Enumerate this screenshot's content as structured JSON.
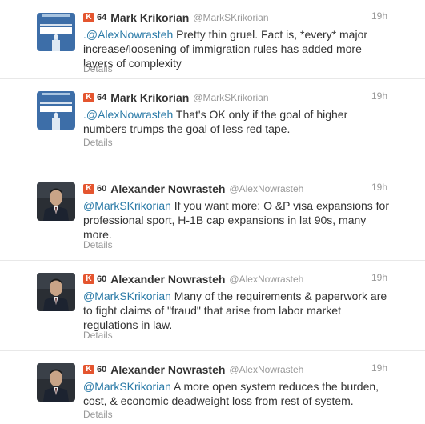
{
  "details_label": "Details",
  "tweets": [
    {
      "klout": "64",
      "name": "Mark Krikorian",
      "handle": "@MarkSKrikorian",
      "time": "19h",
      "mention": ".@AlexNowrasteh",
      "body": " Pretty thin gruel. Fact is, *every* major increase/loosening of immigration rules has added more layers of complexity",
      "avatar": "immigration-book-icon"
    },
    {
      "klout": "64",
      "name": "Mark Krikorian",
      "handle": "@MarkSKrikorian",
      "time": "19h",
      "mention": ".@AlexNowrasteh",
      "body": " That's OK only if the goal of higher numbers trumps the goal of less red tape.",
      "avatar": "immigration-book-icon"
    },
    {
      "klout": "60",
      "name": "Alexander Nowrasteh",
      "handle": "@AlexNowrasteh",
      "time": "19h",
      "mention": "@MarkSKrikorian",
      "body": " If you want more: O &P visa expansions for professional sport, H-1B cap expansions in lat 90s, many more.",
      "avatar": "person-photo-icon"
    },
    {
      "klout": "60",
      "name": "Alexander Nowrasteh",
      "handle": "@AlexNowrasteh",
      "time": "19h",
      "mention": "@MarkSKrikorian",
      "body": " Many of the requirements & paperwork are to fight claims of \"fraud\" that arise from labor market regulations in law.",
      "avatar": "person-photo-icon"
    },
    {
      "klout": "60",
      "name": "Alexander Nowrasteh",
      "handle": "@AlexNowrasteh",
      "time": "19h",
      "mention": "@MarkSKrikorian",
      "body": " A more open system reduces the burden, cost, & economic deadweight loss from rest of system.",
      "avatar": "person-photo-icon"
    }
  ]
}
